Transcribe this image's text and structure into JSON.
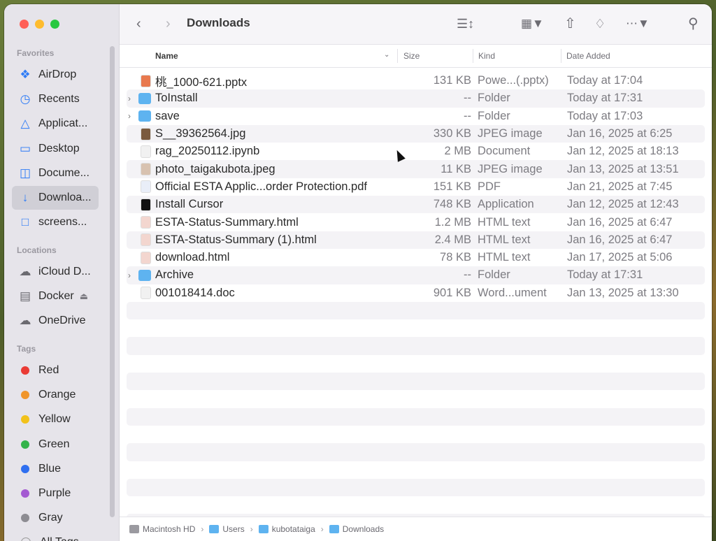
{
  "window": {
    "title": "Downloads"
  },
  "sidebar": {
    "favorites_label": "Favorites",
    "favorites": [
      {
        "label": "AirDrop",
        "icon": "airdrop-icon"
      },
      {
        "label": "Recents",
        "icon": "clock-icon"
      },
      {
        "label": "Applicat...",
        "icon": "applications-icon"
      },
      {
        "label": "Desktop",
        "icon": "desktop-icon"
      },
      {
        "label": "Docume...",
        "icon": "document-icon"
      },
      {
        "label": "Downloa...",
        "icon": "download-icon",
        "selected": true
      },
      {
        "label": "screens...",
        "icon": "folder-icon"
      }
    ],
    "locations_label": "Locations",
    "locations": [
      {
        "label": "iCloud D...",
        "icon": "cloud-icon"
      },
      {
        "label": "Docker",
        "icon": "disk-icon"
      },
      {
        "label": "OneDrive",
        "icon": "cloud-icon"
      }
    ],
    "tags_label": "Tags",
    "tags": [
      {
        "label": "Red",
        "color": "#ea3b35"
      },
      {
        "label": "Orange",
        "color": "#f0952a"
      },
      {
        "label": "Yellow",
        "color": "#f2c21b"
      },
      {
        "label": "Green",
        "color": "#34b34a"
      },
      {
        "label": "Blue",
        "color": "#2f6ff0"
      },
      {
        "label": "Purple",
        "color": "#a45ad2"
      },
      {
        "label": "Gray",
        "color": "#8d8c92"
      },
      {
        "label": "All Tags...",
        "color": ""
      }
    ]
  },
  "columns": {
    "name": "Name",
    "size": "Size",
    "kind": "Kind",
    "date": "Date Added"
  },
  "files": [
    {
      "name": "桃_1000-621.pptx",
      "size": "131 KB",
      "kind": "Powe...(.pptx)",
      "date": "Today at 17:04",
      "folder": false,
      "icon_color": "#e8794e"
    },
    {
      "name": "ToInstall",
      "size": "--",
      "kind": "Folder",
      "date": "Today at 17:31",
      "folder": true,
      "icon_color": "#5eb3f0"
    },
    {
      "name": "save",
      "size": "--",
      "kind": "Folder",
      "date": "Today at 17:03",
      "folder": true,
      "icon_color": "#5eb3f0"
    },
    {
      "name": "S__39362564.jpg",
      "size": "330 KB",
      "kind": "JPEG image",
      "date": "Jan 16, 2025 at 6:25",
      "folder": false,
      "icon_color": "#7a5a3e"
    },
    {
      "name": "rag_20250112.ipynb",
      "size": "2 MB",
      "kind": "Document",
      "date": "Jan 12, 2025 at 18:13",
      "folder": false,
      "icon_color": "#f1f1f1"
    },
    {
      "name": "photo_taigakubota.jpeg",
      "size": "11 KB",
      "kind": "JPEG image",
      "date": "Jan 13, 2025 at 13:51",
      "folder": false,
      "icon_color": "#d8c2b0"
    },
    {
      "name": "Official ESTA Applic...order Protection.pdf",
      "size": "151 KB",
      "kind": "PDF",
      "date": "Jan 21, 2025 at 7:45",
      "folder": false,
      "icon_color": "#e9eef8"
    },
    {
      "name": "Install Cursor",
      "size": "748 KB",
      "kind": "Application",
      "date": "Jan 12, 2025 at 12:43",
      "folder": false,
      "icon_color": "#111111"
    },
    {
      "name": "ESTA-Status-Summary.html",
      "size": "1.2 MB",
      "kind": "HTML text",
      "date": "Jan 16, 2025 at 6:47",
      "folder": false,
      "icon_color": "#f3d6cf"
    },
    {
      "name": "ESTA-Status-Summary (1).html",
      "size": "2.4 MB",
      "kind": "HTML text",
      "date": "Jan 16, 2025 at 6:47",
      "folder": false,
      "icon_color": "#f3d6cf"
    },
    {
      "name": "download.html",
      "size": "78 KB",
      "kind": "HTML text",
      "date": "Jan 17, 2025 at 5:06",
      "folder": false,
      "icon_color": "#f3d6cf"
    },
    {
      "name": "Archive",
      "size": "--",
      "kind": "Folder",
      "date": "Today at 17:31",
      "folder": true,
      "icon_color": "#5eb3f0"
    },
    {
      "name": "001018414.doc",
      "size": "901 KB",
      "kind": "Word...ument",
      "date": "Jan 13, 2025 at 13:30",
      "folder": false,
      "icon_color": "#f1f1f1"
    }
  ],
  "empty_rows": 13,
  "path": [
    {
      "label": "Macintosh HD",
      "color": "#9b9aa0"
    },
    {
      "label": "Users",
      "color": "#5eb3f0"
    },
    {
      "label": "kubotataiga",
      "color": "#5eb3f0"
    },
    {
      "label": "Downloads",
      "color": "#5eb3f0"
    }
  ]
}
